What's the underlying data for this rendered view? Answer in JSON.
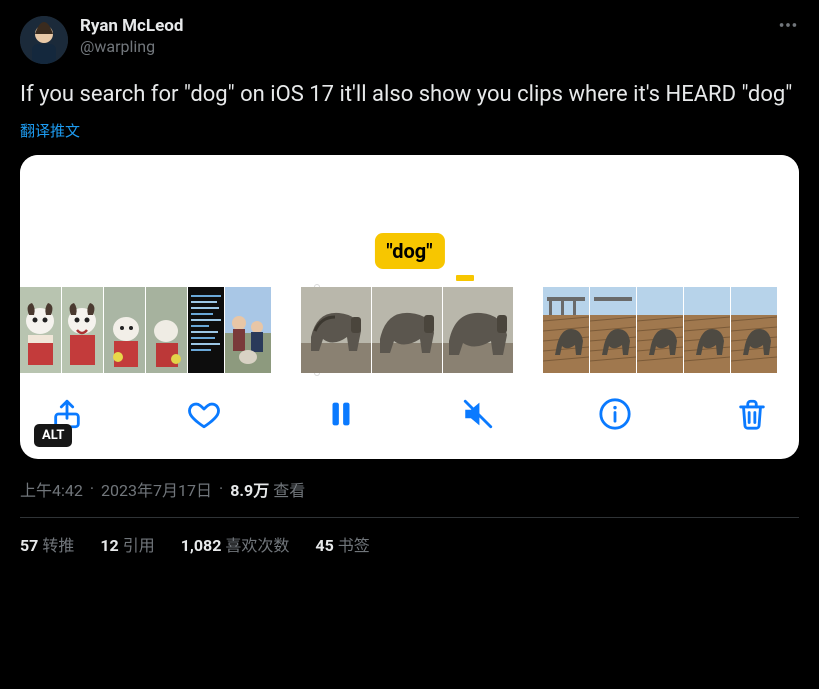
{
  "author": {
    "display_name": "Ryan McLeod",
    "handle": "@warpling"
  },
  "tweet_text": "If you search for \"dog\" on iOS 17 it'll also show you clips where it's HEARD \"dog\"",
  "translate_label": "翻译推文",
  "media": {
    "dog_label": "\"dog\"",
    "alt_badge": "ALT",
    "controls": {
      "share": "share-icon",
      "like": "heart-icon",
      "pause": "pause-icon",
      "mute": "mute-icon",
      "info": "info-icon",
      "trash": "trash-icon"
    }
  },
  "meta": {
    "time": "上午4:42",
    "date": "2023年7月17日",
    "views_value": "8.9万",
    "views_label": "查看"
  },
  "stats": {
    "retweets": {
      "count": "57",
      "label": "转推"
    },
    "quotes": {
      "count": "12",
      "label": "引用"
    },
    "likes": {
      "count": "1,082",
      "label": "喜欢次数"
    },
    "bookmarks": {
      "count": "45",
      "label": "书签"
    }
  }
}
